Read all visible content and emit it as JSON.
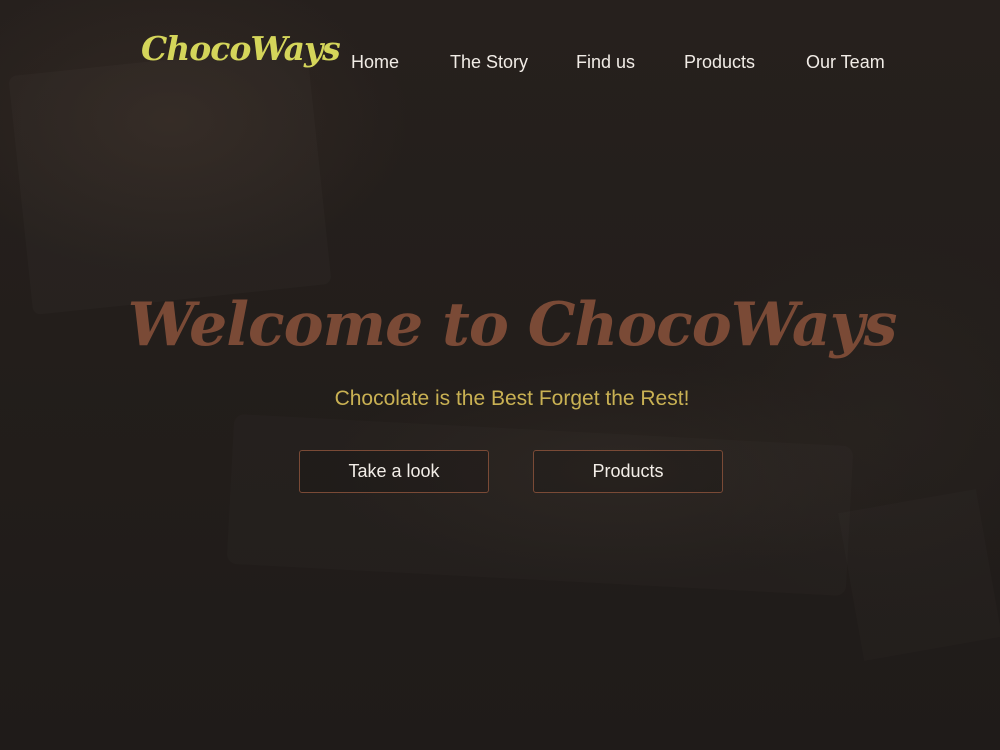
{
  "brand": {
    "logo_text": "ChocoWays"
  },
  "nav": {
    "items": [
      {
        "label": "Home"
      },
      {
        "label": "The Story"
      },
      {
        "label": "Find us"
      },
      {
        "label": "Products"
      },
      {
        "label": "Our Team"
      }
    ]
  },
  "hero": {
    "title": "Welcome to ChocoWays",
    "subtitle": "Chocolate is the Best Forget the Rest!",
    "buttons": [
      {
        "label": "Take a look"
      },
      {
        "label": "Products"
      }
    ]
  },
  "colors": {
    "background": "#221d1b",
    "logo": "#d4d55a",
    "title": "#7a4a36",
    "subtitle": "#c9b153",
    "nav_text": "#f1ece6",
    "button_border": "#7a4a36"
  }
}
